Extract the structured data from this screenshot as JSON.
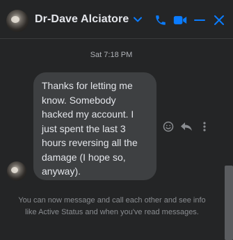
{
  "header": {
    "contact_name": "Dr-Dave Alciatore",
    "icons": {
      "chevron": "chevron-down-icon",
      "call": "phone-icon",
      "video": "video-camera-icon",
      "minimize": "minimize-icon",
      "close": "close-icon"
    }
  },
  "conversation": {
    "timestamp": "Sat 7:18 PM",
    "message": {
      "text": "Thanks for letting me know.  Somebody hacked my account.  I just spent the last 3 hours reversing all the damage (I hope so, anyway).",
      "actions": [
        "emoji-react-icon",
        "reply-icon",
        "more-options-icon"
      ]
    },
    "notice": "You can now message and call each other and see info like Active Status and when you've read messages."
  },
  "colors": {
    "background": "#242526",
    "bubble": "#3e4042",
    "accent": "#0a7cff",
    "text_primary": "#e4e6eb",
    "text_secondary": "#b0b3b8"
  }
}
